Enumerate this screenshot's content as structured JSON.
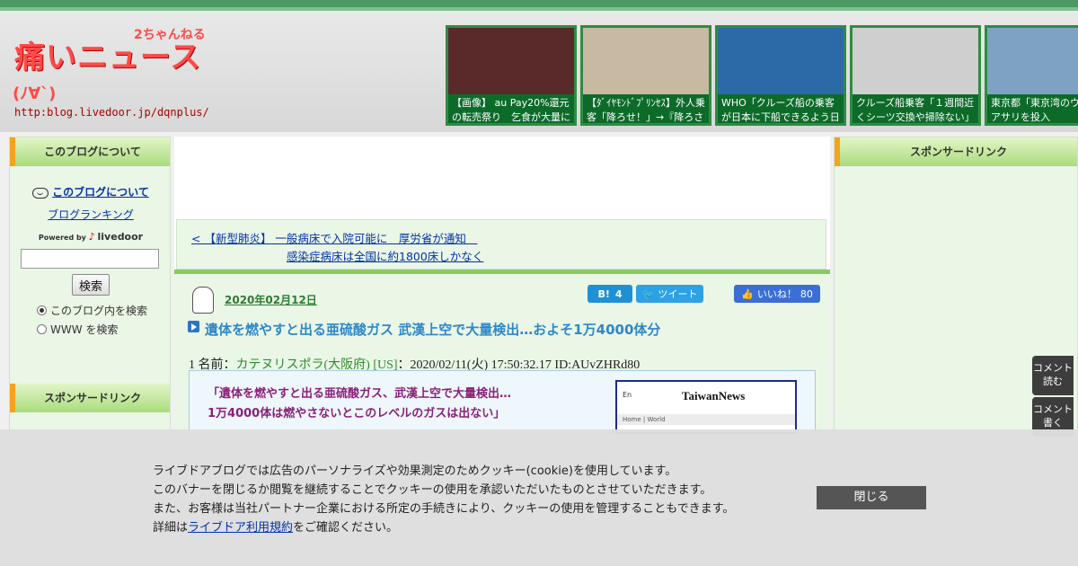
{
  "header": {
    "logo_main": "痛いニュース",
    "logo_sub": "2ちゃんねる",
    "logo_face": "(ﾉ∀`)",
    "logo_url": "http:blog.livedoor.jp/dqnplus/",
    "thumbnails": [
      {
        "caption": "【画像】 au Pay20%還元の転売祭り　乞食が大量に",
        "color": "#5a2a2a"
      },
      {
        "caption": "【ﾀﾞｲﾔﾓﾝﾄﾞﾌﾟﾘﾝｾｽ】外人乗客「降ろせ！」→『降ろさ",
        "color": "#c7b9a2"
      },
      {
        "caption": "WHO「クルーズ船の乗客が日本に下船できるよう日",
        "color": "#2b6aa7"
      },
      {
        "caption": "クルーズ船乗客「１週間近くシーツ交換や掃除ない」",
        "color": "#cfcfcf"
      },
      {
        "caption": "東京都「東京湾のウ対策にアサリを投入",
        "color": "#7ea2c4"
      }
    ]
  },
  "left_sidebar": {
    "about_heading": "このブログについて",
    "about_link": "このブログについて",
    "ranking_link": "ブログランキング",
    "powered_prefix": "Powered by",
    "powered_brand": "livedoor",
    "search_button": "検索",
    "radio_blog": "このブログ内を検索",
    "radio_www": "WWW を検索",
    "sponsor_heading": "スポンサードリンク"
  },
  "right_sidebar": {
    "sponsor_heading": "スポンサードリンク"
  },
  "main": {
    "prev_line1": "< 【新型肺炎】 一般病床で入院可能に　厚労省が通知　",
    "prev_line2": "感染症病床は全国に約1800床しかなく",
    "date": "2020年02月12日",
    "hatena_label": "B!",
    "hatena_count": "4",
    "tweet_label": "ツイート",
    "like_label": "いいね！",
    "like_count": "80",
    "title": "遺体を燃やすと出る亜硫酸ガス 武漢上空で大量検出…およそ1万4000体分",
    "meta_prefix": "1 名前：",
    "meta_name": "カテヌリスポラ(大阪府) [US]",
    "meta_rest": "：2020/02/11(火) 17:50:32.17 ID:AUvZHRd80",
    "quote_line1": "「遺体を燃やすと出る亜硫酸ガス、武漢上空で大量検出…",
    "quote_line2": "1万4000体は燃やさないとこのレベルのガスは出ない」",
    "news_logo": "TaiwanNews",
    "news_nav": "En",
    "news_bar": "Home | World"
  },
  "float_buttons": {
    "read": "コメント読む",
    "write": "コメント書く"
  },
  "cookie": {
    "line1": "ライブドアブログでは広告のパーソナライズや効果測定のためクッキー(cookie)を使用しています。",
    "line2": "このバナーを閉じるか閲覧を継続することでクッキーの使用を承認いただいたものとさせていただきます。",
    "line3": "また、お客様は当社パートナー企業における所定の手続きにより、クッキーの使用を管理することもできます。",
    "line4_prefix": "詳細は",
    "line4_link": "ライブドア利用規約",
    "line4_suffix": "をご確認ください。",
    "close_button": "閉じる"
  }
}
